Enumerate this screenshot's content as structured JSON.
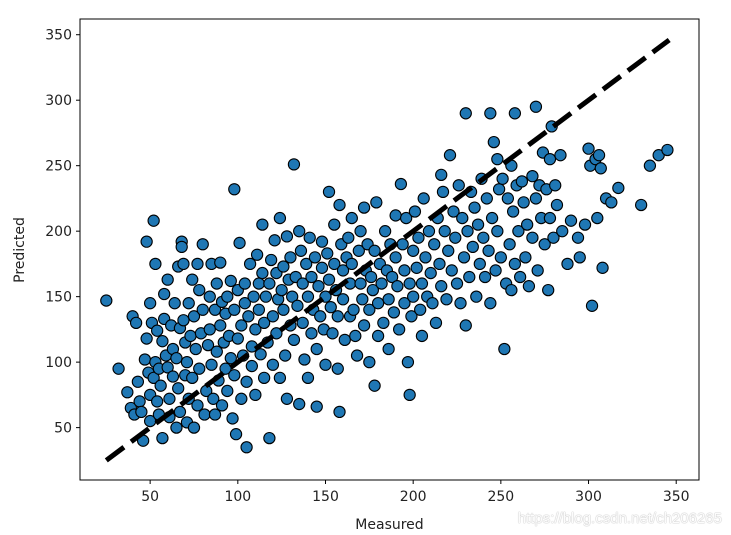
{
  "chart_data": {
    "type": "scatter",
    "title": "",
    "xlabel": "Measured",
    "ylabel": "Predicted",
    "xlim": [
      10,
      363
    ],
    "ylim": [
      10,
      362
    ],
    "xticks": [
      50,
      100,
      150,
      200,
      250,
      300,
      350
    ],
    "yticks": [
      50,
      100,
      150,
      200,
      250,
      300,
      350
    ],
    "xtick_labels": [
      "50",
      "100",
      "150",
      "200",
      "250",
      "300",
      "350"
    ],
    "ytick_labels": [
      "50",
      "100",
      "150",
      "200",
      "250",
      "300",
      "350"
    ],
    "grid": false,
    "legend": "none",
    "marker_color": "#1f77b4",
    "marker_edge_color": "#000000",
    "reference_line": {
      "style": "dashed",
      "color": "#000000",
      "x": [
        25,
        346
      ],
      "y": [
        25,
        346
      ]
    },
    "points": [
      [
        25,
        147
      ],
      [
        32,
        95
      ],
      [
        37,
        77
      ],
      [
        39,
        65
      ],
      [
        40,
        135
      ],
      [
        41,
        60
      ],
      [
        42,
        130
      ],
      [
        43,
        85
      ],
      [
        44,
        70
      ],
      [
        45,
        62
      ],
      [
        46,
        40
      ],
      [
        47,
        102
      ],
      [
        48,
        192
      ],
      [
        48,
        118
      ],
      [
        49,
        92
      ],
      [
        50,
        75
      ],
      [
        50,
        145
      ],
      [
        50,
        55
      ],
      [
        51,
        130
      ],
      [
        52,
        88
      ],
      [
        52,
        208
      ],
      [
        53,
        100
      ],
      [
        53,
        175
      ],
      [
        54,
        70
      ],
      [
        54,
        124
      ],
      [
        55,
        95
      ],
      [
        55,
        60
      ],
      [
        56,
        82
      ],
      [
        57,
        116
      ],
      [
        57,
        42
      ],
      [
        58,
        152
      ],
      [
        58,
        133
      ],
      [
        59,
        105
      ],
      [
        60,
        163
      ],
      [
        60,
        96
      ],
      [
        61,
        72
      ],
      [
        61,
        58
      ],
      [
        62,
        128
      ],
      [
        63,
        89
      ],
      [
        63,
        110
      ],
      [
        64,
        145
      ],
      [
        65,
        50
      ],
      [
        65,
        103
      ],
      [
        66,
        173
      ],
      [
        66,
        80
      ],
      [
        67,
        126
      ],
      [
        67,
        62
      ],
      [
        68,
        192
      ],
      [
        68,
        188
      ],
      [
        69,
        175
      ],
      [
        69,
        132
      ],
      [
        70,
        115
      ],
      [
        70,
        90
      ],
      [
        71,
        100
      ],
      [
        71,
        54
      ],
      [
        72,
        72
      ],
      [
        72,
        145
      ],
      [
        73,
        120
      ],
      [
        74,
        163
      ],
      [
        74,
        88
      ],
      [
        75,
        135
      ],
      [
        75,
        50
      ],
      [
        76,
        110
      ],
      [
        77,
        175
      ],
      [
        77,
        67
      ],
      [
        78,
        155
      ],
      [
        78,
        95
      ],
      [
        79,
        122
      ],
      [
        80,
        190
      ],
      [
        80,
        140
      ],
      [
        81,
        60
      ],
      [
        82,
        78
      ],
      [
        83,
        113
      ],
      [
        84,
        150
      ],
      [
        84,
        125
      ],
      [
        85,
        175
      ],
      [
        85,
        98
      ],
      [
        86,
        72
      ],
      [
        87,
        140
      ],
      [
        87,
        60
      ],
      [
        88,
        160
      ],
      [
        88,
        108
      ],
      [
        89,
        86
      ],
      [
        90,
        128
      ],
      [
        90,
        176
      ],
      [
        91,
        146
      ],
      [
        91,
        67
      ],
      [
        92,
        115
      ],
      [
        93,
        95
      ],
      [
        93,
        137
      ],
      [
        94,
        150
      ],
      [
        94,
        78
      ],
      [
        95,
        120
      ],
      [
        96,
        162
      ],
      [
        96,
        103
      ],
      [
        97,
        57
      ],
      [
        98,
        232
      ],
      [
        98,
        140
      ],
      [
        98,
        90
      ],
      [
        99,
        45
      ],
      [
        100,
        118
      ],
      [
        100,
        155
      ],
      [
        101,
        191
      ],
      [
        102,
        72
      ],
      [
        102,
        128
      ],
      [
        103,
        105
      ],
      [
        104,
        160
      ],
      [
        104,
        145
      ],
      [
        105,
        85
      ],
      [
        105,
        35
      ],
      [
        106,
        135
      ],
      [
        107,
        175
      ],
      [
        108,
        112
      ],
      [
        108,
        97
      ],
      [
        109,
        150
      ],
      [
        110,
        125
      ],
      [
        110,
        75
      ],
      [
        111,
        182
      ],
      [
        112,
        160
      ],
      [
        112,
        140
      ],
      [
        113,
        106
      ],
      [
        114,
        205
      ],
      [
        114,
        168
      ],
      [
        115,
        88
      ],
      [
        115,
        130
      ],
      [
        116,
        150
      ],
      [
        117,
        115
      ],
      [
        118,
        160
      ],
      [
        118,
        42
      ],
      [
        119,
        178
      ],
      [
        120,
        135
      ],
      [
        120,
        98
      ],
      [
        121,
        193
      ],
      [
        122,
        168
      ],
      [
        122,
        122
      ],
      [
        123,
        148
      ],
      [
        124,
        210
      ],
      [
        124,
        88
      ],
      [
        125,
        155
      ],
      [
        126,
        173
      ],
      [
        126,
        140
      ],
      [
        127,
        105
      ],
      [
        128,
        196
      ],
      [
        128,
        72
      ],
      [
        129,
        163
      ],
      [
        130,
        128
      ],
      [
        130,
        180
      ],
      [
        131,
        150
      ],
      [
        132,
        251
      ],
      [
        132,
        117
      ],
      [
        133,
        165
      ],
      [
        134,
        143
      ],
      [
        135,
        200
      ],
      [
        135,
        68
      ],
      [
        136,
        185
      ],
      [
        137,
        160
      ],
      [
        137,
        130
      ],
      [
        138,
        102
      ],
      [
        139,
        175
      ],
      [
        140,
        150
      ],
      [
        140,
        88
      ],
      [
        141,
        195
      ],
      [
        142,
        122
      ],
      [
        142,
        165
      ],
      [
        143,
        140
      ],
      [
        144,
        180
      ],
      [
        145,
        110
      ],
      [
        145,
        66
      ],
      [
        146,
        158
      ],
      [
        147,
        135
      ],
      [
        148,
        172
      ],
      [
        148,
        192
      ],
      [
        149,
        125
      ],
      [
        150,
        150
      ],
      [
        150,
        98
      ],
      [
        151,
        183
      ],
      [
        152,
        230
      ],
      [
        152,
        163
      ],
      [
        153,
        142
      ],
      [
        154,
        122
      ],
      [
        155,
        205
      ],
      [
        155,
        175
      ],
      [
        156,
        155
      ],
      [
        157,
        135
      ],
      [
        157,
        95
      ],
      [
        158,
        62
      ],
      [
        158,
        220
      ],
      [
        159,
        190
      ],
      [
        160,
        170
      ],
      [
        160,
        148
      ],
      [
        161,
        117
      ],
      [
        162,
        180
      ],
      [
        163,
        195
      ],
      [
        164,
        160
      ],
      [
        164,
        135
      ],
      [
        165,
        210
      ],
      [
        165,
        175
      ],
      [
        166,
        140
      ],
      [
        167,
        120
      ],
      [
        168,
        105
      ],
      [
        169,
        185
      ],
      [
        170,
        160
      ],
      [
        170,
        200
      ],
      [
        171,
        148
      ],
      [
        172,
        218
      ],
      [
        172,
        128
      ],
      [
        173,
        170
      ],
      [
        174,
        190
      ],
      [
        175,
        140
      ],
      [
        175,
        100
      ],
      [
        176,
        165
      ],
      [
        177,
        155
      ],
      [
        178,
        185
      ],
      [
        178,
        82
      ],
      [
        179,
        222
      ],
      [
        180,
        145
      ],
      [
        180,
        120
      ],
      [
        181,
        175
      ],
      [
        182,
        160
      ],
      [
        183,
        130
      ],
      [
        184,
        200
      ],
      [
        185,
        170
      ],
      [
        186,
        148
      ],
      [
        186,
        110
      ],
      [
        187,
        190
      ],
      [
        188,
        165
      ],
      [
        189,
        138
      ],
      [
        190,
        212
      ],
      [
        190,
        180
      ],
      [
        191,
        158
      ],
      [
        192,
        125
      ],
      [
        193,
        236
      ],
      [
        194,
        190
      ],
      [
        195,
        170
      ],
      [
        195,
        145
      ],
      [
        196,
        210
      ],
      [
        197,
        100
      ],
      [
        198,
        160
      ],
      [
        198,
        75
      ],
      [
        199,
        135
      ],
      [
        200,
        185
      ],
      [
        200,
        150
      ],
      [
        201,
        215
      ],
      [
        202,
        172
      ],
      [
        203,
        195
      ],
      [
        204,
        140
      ],
      [
        205,
        160
      ],
      [
        205,
        120
      ],
      [
        206,
        225
      ],
      [
        207,
        180
      ],
      [
        208,
        150
      ],
      [
        209,
        200
      ],
      [
        210,
        168
      ],
      [
        211,
        145
      ],
      [
        212,
        190
      ],
      [
        213,
        130
      ],
      [
        214,
        210
      ],
      [
        215,
        175
      ],
      [
        216,
        243
      ],
      [
        216,
        158
      ],
      [
        217,
        230
      ],
      [
        218,
        200
      ],
      [
        219,
        148
      ],
      [
        220,
        185
      ],
      [
        221,
        258
      ],
      [
        222,
        170
      ],
      [
        223,
        215
      ],
      [
        224,
        195
      ],
      [
        225,
        160
      ],
      [
        226,
        235
      ],
      [
        227,
        145
      ],
      [
        228,
        210
      ],
      [
        229,
        180
      ],
      [
        230,
        290
      ],
      [
        230,
        128
      ],
      [
        231,
        200
      ],
      [
        232,
        165
      ],
      [
        233,
        230
      ],
      [
        234,
        188
      ],
      [
        235,
        218
      ],
      [
        236,
        150
      ],
      [
        237,
        205
      ],
      [
        238,
        175
      ],
      [
        239,
        240
      ],
      [
        240,
        195
      ],
      [
        241,
        165
      ],
      [
        242,
        225
      ],
      [
        243,
        185
      ],
      [
        244,
        290
      ],
      [
        244,
        145
      ],
      [
        245,
        210
      ],
      [
        246,
        268
      ],
      [
        247,
        170
      ],
      [
        248,
        255
      ],
      [
        248,
        200
      ],
      [
        249,
        232
      ],
      [
        250,
        180
      ],
      [
        251,
        240
      ],
      [
        252,
        110
      ],
      [
        253,
        160
      ],
      [
        254,
        225
      ],
      [
        255,
        190
      ],
      [
        256,
        250
      ],
      [
        256,
        155
      ],
      [
        257,
        215
      ],
      [
        258,
        290
      ],
      [
        258,
        175
      ],
      [
        259,
        235
      ],
      [
        260,
        200
      ],
      [
        261,
        165
      ],
      [
        262,
        238
      ],
      [
        263,
        222
      ],
      [
        264,
        180
      ],
      [
        265,
        205
      ],
      [
        266,
        158
      ],
      [
        268,
        242
      ],
      [
        268,
        195
      ],
      [
        270,
        295
      ],
      [
        270,
        225
      ],
      [
        271,
        170
      ],
      [
        272,
        235
      ],
      [
        273,
        210
      ],
      [
        274,
        260
      ],
      [
        275,
        190
      ],
      [
        276,
        232
      ],
      [
        277,
        155
      ],
      [
        278,
        255
      ],
      [
        278,
        210
      ],
      [
        279,
        280
      ],
      [
        280,
        195
      ],
      [
        281,
        235
      ],
      [
        282,
        220
      ],
      [
        284,
        258
      ],
      [
        285,
        200
      ],
      [
        288,
        175
      ],
      [
        290,
        208
      ],
      [
        294,
        195
      ],
      [
        295,
        180
      ],
      [
        298,
        205
      ],
      [
        300,
        263
      ],
      [
        301,
        250
      ],
      [
        302,
        143
      ],
      [
        304,
        255
      ],
      [
        305,
        210
      ],
      [
        306,
        258
      ],
      [
        307,
        248
      ],
      [
        308,
        172
      ],
      [
        310,
        225
      ],
      [
        313,
        222
      ],
      [
        317,
        233
      ],
      [
        330,
        220
      ],
      [
        335,
        250
      ],
      [
        340,
        258
      ],
      [
        345,
        262
      ]
    ]
  },
  "watermark": "https://blog.csdn.net/ch206265"
}
